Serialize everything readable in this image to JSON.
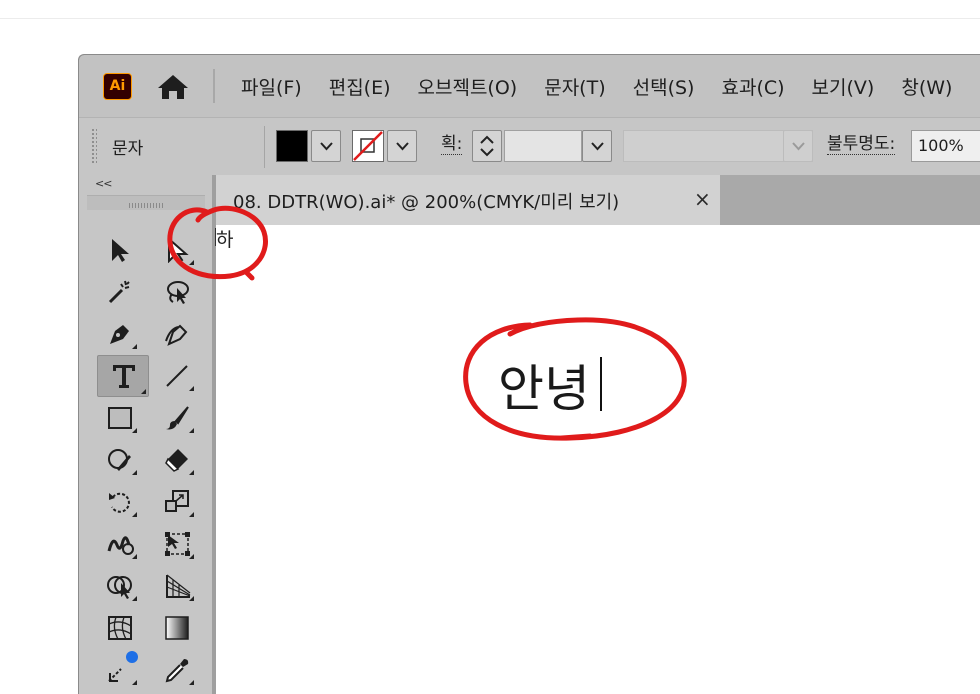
{
  "app": {
    "logo_text": "Ai",
    "accent": "#ff9a00"
  },
  "menu": [
    "파일(F)",
    "편집(E)",
    "오브젝트(O)",
    "문자(T)",
    "선택(S)",
    "효과(C)",
    "보기(V)",
    "창(W)"
  ],
  "control_bar": {
    "mode_label": "문자",
    "fill_color": "#000000",
    "stroke_state": "none",
    "stroke_label": "획:",
    "stroke_value": "",
    "opacity_label": "불투명도:",
    "opacity_value": "100%"
  },
  "toolbar": {
    "collapse_label": "<<",
    "active_tool": "type-tool",
    "tools": [
      "selection-tool",
      "direct-selection-tool",
      "magic-wand-tool",
      "lasso-tool",
      "pen-tool",
      "curvature-tool",
      "type-tool",
      "line-segment-tool",
      "rectangle-tool",
      "paintbrush-tool",
      "shaper-tool",
      "eraser-tool",
      "rotate-tool",
      "scale-tool",
      "warp-tool",
      "free-transform-tool",
      "shape-builder-tool",
      "perspective-grid-tool",
      "mesh-tool",
      "gradient-tool",
      "eyedropper-tool",
      "measure-tool"
    ]
  },
  "document_tab": {
    "title": "08.  DDTR(WO).ai*  @  200%(CMYK/미리 보기)",
    "close_label": "×"
  },
  "canvas": {
    "small_text": "하",
    "main_text": "안녕"
  },
  "annotations": {
    "color": "#e01b1b"
  }
}
